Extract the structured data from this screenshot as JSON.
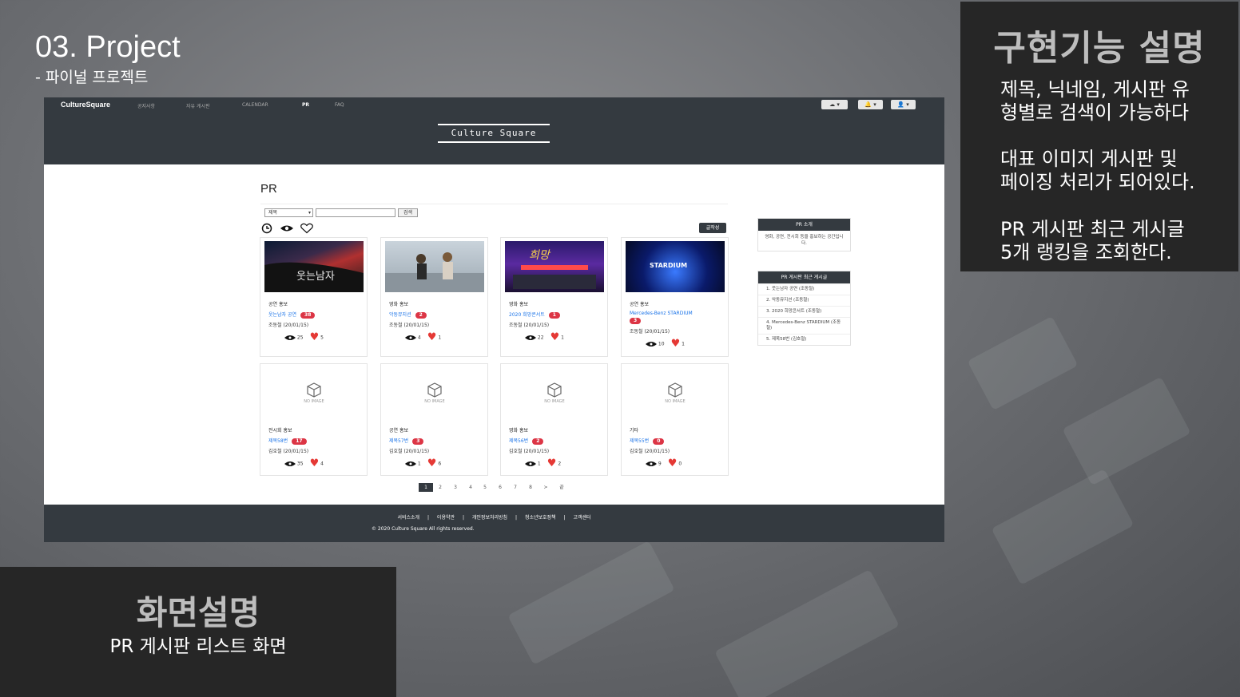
{
  "slide": {
    "title": "03. Project",
    "subtitle": "- 파이널 프로젝트"
  },
  "info_panel": {
    "heading": "구현기능 설명",
    "paragraphs": [
      [
        "제목, 닉네임, 게시판 유",
        "형별로 검색이 가능하다"
      ],
      [
        "대표 이미지 게시판 및",
        "페이징 처리가 되어있다."
      ],
      [
        "PR 게시판 최근 게시글",
        "5개 랭킹을 조회한다."
      ]
    ]
  },
  "desc_panel": {
    "heading": "화면설명",
    "text": "PR 게시판 리스트 화면"
  },
  "site": {
    "brand": "CultureSquare",
    "nav": [
      "공지사항",
      "자유 게시판",
      "CALENDAR",
      "PR",
      "FAQ"
    ],
    "header_buttons": [
      "☁ ▾",
      "🔔 ▾",
      "👤 ▾"
    ],
    "logo": "Culture Square",
    "page_heading": "PR",
    "search": {
      "select_value": "제목",
      "button": "검색"
    },
    "write_button": "글작성",
    "cards": [
      {
        "category": "공연 홍보",
        "title": "웃는남자 공연",
        "badge": "38",
        "author": "조동철 (20/01/15)",
        "views": "25",
        "likes": "5",
        "image": "poster-1"
      },
      {
        "category": "영화 홍보",
        "title": "악동뮤지션",
        "badge": "2",
        "author": "조동철 (20/01/15)",
        "views": "4",
        "likes": "1",
        "image": "poster-2"
      },
      {
        "category": "영화 홍보",
        "title": "2020 희망콘서트",
        "badge": "1",
        "author": "조동철 (20/01/15)",
        "views": "22",
        "likes": "1",
        "image": "poster-3"
      },
      {
        "category": "공연 홍보",
        "title": "Mercedes-Benz STARDIUM",
        "badge": "3",
        "author": "조동철 (20/01/15)",
        "views": "10",
        "likes": "1",
        "image": "poster-4"
      },
      {
        "category": "전시회 홍보",
        "title": "제목58번",
        "badge": "17",
        "author": "김호철 (20/01/15)",
        "views": "35",
        "likes": "4",
        "image": "none"
      },
      {
        "category": "공연 홍보",
        "title": "제목57번",
        "badge": "3",
        "author": "김호철 (20/01/15)",
        "views": "1",
        "likes": "6",
        "image": "none"
      },
      {
        "category": "영화 홍보",
        "title": "제목56번",
        "badge": "2",
        "author": "김호철 (20/01/15)",
        "views": "1",
        "likes": "2",
        "image": "none"
      },
      {
        "category": "기타",
        "title": "제목55번",
        "badge": "0",
        "author": "김호철 (20/01/15)",
        "views": "9",
        "likes": "0",
        "image": "none"
      }
    ],
    "no_image_label": "NO IMAGE",
    "pagination": [
      "1",
      "2",
      "3",
      "4",
      "5",
      "6",
      "7",
      "8",
      ">",
      "끝"
    ],
    "sidebar": {
      "intro_title": "PR 소개",
      "intro_text": "영화, 공연, 전시회 등을 홍보하는 공간입니다.",
      "recent_title": "PR 게시판 최근 게시글",
      "recent": [
        "1. 웃는남자 공연 (조동철)",
        "2. 악동뮤지션 (조동철)",
        "3. 2020 희망콘서트 (조동철)",
        "4. Mercedes-Benz STARDIUM (조동철)",
        "5. 제목58번 (김호철)"
      ]
    },
    "footer": {
      "links": [
        "서비스소개",
        "|",
        "이용약관",
        "|",
        "개인정보처리방침",
        "|",
        "청소년보호정책",
        "|",
        "고객센터"
      ],
      "copyright": "© 2020 Culture Square   All rights reserved."
    }
  },
  "colors": {
    "header_bg": "#343a40",
    "badge": "#dc3545",
    "heart": "#e53935",
    "panel_bg": "#262626"
  }
}
